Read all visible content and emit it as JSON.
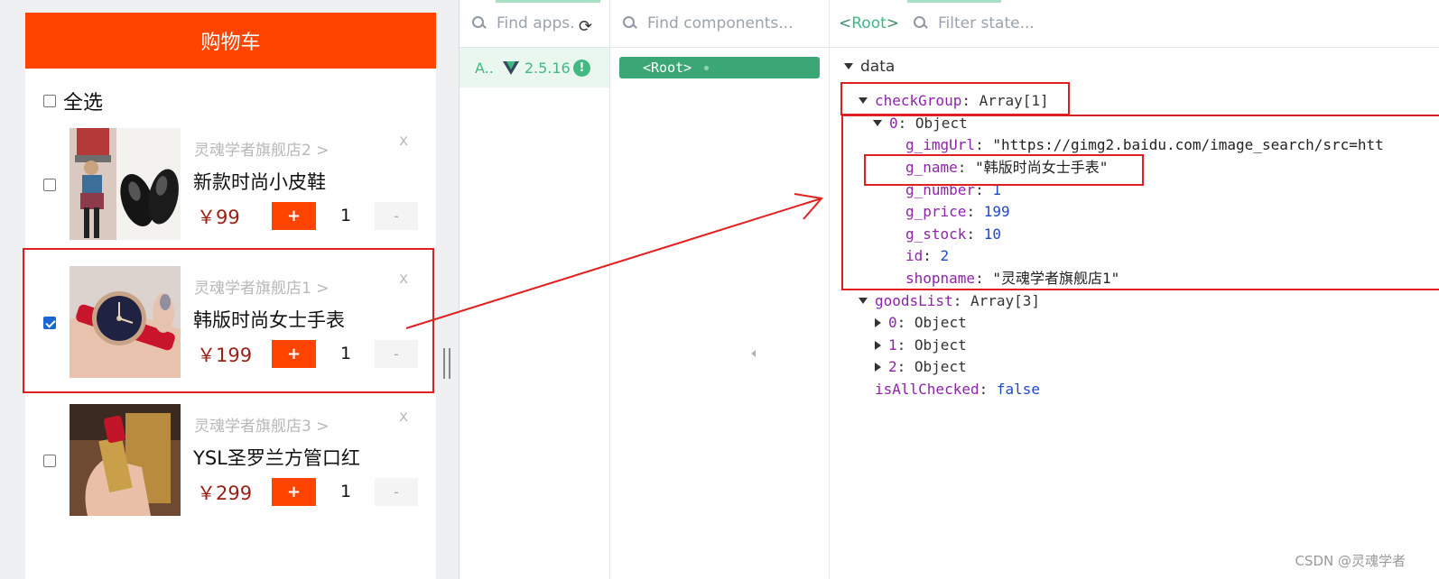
{
  "cart": {
    "title": "购物车",
    "select_all_label": "全选",
    "select_all_checked": false,
    "remove_label": "x",
    "plus_label": "+",
    "minus_label": "-",
    "items": [
      {
        "shop": "灵魂学者旗舰店2 >",
        "name": "新款时尚小皮鞋",
        "price": "￥99",
        "qty": "1",
        "checked": false
      },
      {
        "shop": "灵魂学者旗舰店1 >",
        "name": "韩版时尚女士手表",
        "price": "￥199",
        "qty": "1",
        "checked": true
      },
      {
        "shop": "灵魂学者旗舰店3 >",
        "name": "YSL圣罗兰方管口红",
        "price": "￥299",
        "qty": "1",
        "checked": false
      }
    ]
  },
  "devtools": {
    "apps_search_placeholder": "Find apps...",
    "app": {
      "name": "A..",
      "version": "2.5.16",
      "warning": "!"
    },
    "components_search_placeholder": "Find components...",
    "root_label": "<Root>",
    "selected_component": {
      "open": "<",
      "name": "Root",
      "close": ">"
    },
    "state_filter_placeholder": "Filter state...",
    "state": {
      "section": "data",
      "rows": [
        {
          "key": "checkGroup",
          "sep": ": ",
          "value": "Array[1]",
          "kind": "typ"
        },
        {
          "key": "0",
          "sep": ": ",
          "value": "Object",
          "kind": "typ"
        },
        {
          "key": "g_imgUrl",
          "sep": ": ",
          "value": "\"https://gimg2.baidu.com/image_search/src=htt",
          "kind": "str"
        },
        {
          "key": "g_name",
          "sep": ": ",
          "value": "\"韩版时尚女士手表\"",
          "kind": "str"
        },
        {
          "key": "g_number",
          "sep": ": ",
          "value": "1",
          "kind": "num"
        },
        {
          "key": "g_price",
          "sep": ": ",
          "value": "199",
          "kind": "num"
        },
        {
          "key": "g_stock",
          "sep": ": ",
          "value": "10",
          "kind": "num"
        },
        {
          "key": "id",
          "sep": ": ",
          "value": "2",
          "kind": "num"
        },
        {
          "key": "shopname",
          "sep": ": ",
          "value": "\"灵魂学者旗舰店1\"",
          "kind": "str"
        },
        {
          "key": "goodsList",
          "sep": ": ",
          "value": "Array[3]",
          "kind": "typ"
        },
        {
          "key": "0",
          "sep": ": ",
          "value": "Object",
          "kind": "typ"
        },
        {
          "key": "1",
          "sep": ": ",
          "value": "Object",
          "kind": "typ"
        },
        {
          "key": "2",
          "sep": ": ",
          "value": "Object",
          "kind": "typ"
        },
        {
          "key": "isAllChecked",
          "sep": ": ",
          "value": "false",
          "kind": "bool"
        }
      ]
    }
  },
  "watermark": "CSDN @灵魂学者",
  "colors": {
    "cart_header": "#ff4400",
    "price": "#9a1f14",
    "vue_green": "#42b883",
    "annotation_red": "#e02020"
  }
}
